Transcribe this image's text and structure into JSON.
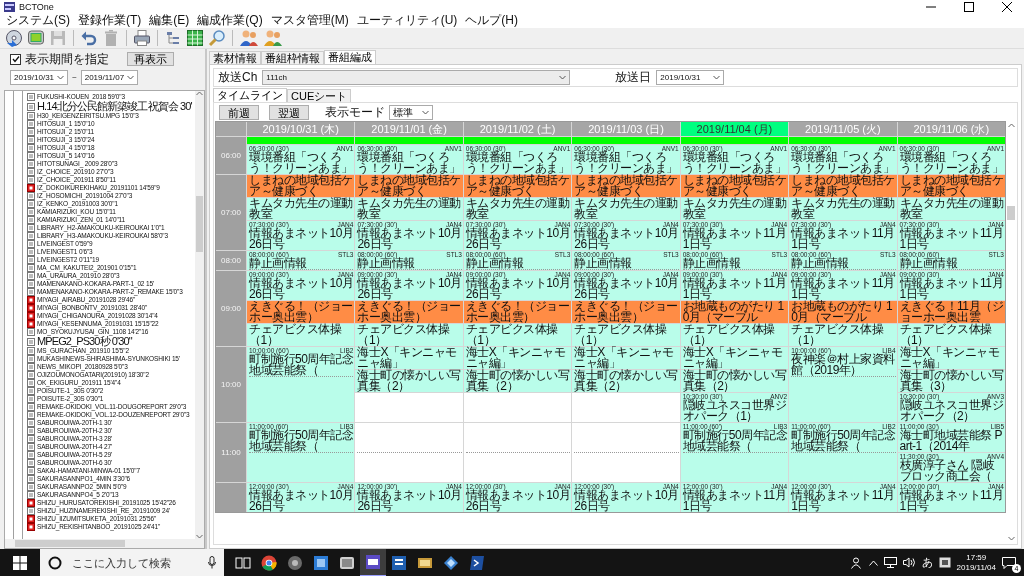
{
  "window": {
    "title": "BCTOne"
  },
  "menu": [
    "システム(S)",
    "登録作業(T)",
    "編集(E)",
    "編成作業(Q)",
    "マスタ管理(M)",
    "ユーティリティ(U)",
    "ヘルプ(H)"
  ],
  "toolbar": [
    {
      "disabled": false
    },
    {
      "disabled": false
    },
    {
      "disabled": true
    },
    {
      "disabled": false
    },
    {
      "disabled": true
    },
    {
      "disabled": false
    },
    {
      "disabled": false
    },
    {
      "disabled": false
    },
    {
      "disabled": false
    },
    {
      "disabled": false
    },
    {
      "disabled": false
    }
  ],
  "filter": {
    "period_checkbox": {
      "label": "表示期間を指定",
      "checked": true
    },
    "refresh_button": "再表示",
    "date_from": "2019/10/31",
    "separator": "~",
    "date_to": "2019/11/07"
  },
  "tree": {
    "items": [
      {
        "label": "FUKUSHI-KOUEN_2018 59'0\"3",
        "flagged": false
      },
      {
        "label": "H.14北分公民館新築竣工祝賀会 30'",
        "flagged": false
      },
      {
        "label": "H30_KEIGENZEIRITSU.MPG 15'0\"3",
        "flagged": false
      },
      {
        "label": "HITOSUJI_1 15'0\"10",
        "flagged": false
      },
      {
        "label": "HITOSUJI_2 15'0\"11",
        "flagged": false
      },
      {
        "label": "HITOSUJI_3 15'0\"24",
        "flagged": false
      },
      {
        "label": "HITOSUJI_4 15'0\"18",
        "flagged": false
      },
      {
        "label": "HITOSUJI_5 14'0\"16",
        "flagged": false
      },
      {
        "label": "HITOTSUNAGI_ 2009 28'0\"3",
        "flagged": false
      },
      {
        "label": "IZ_CHOICE_201910 27'0\"3",
        "flagged": false
      },
      {
        "label": "IZ_CHOICE_201911 8'50\"11",
        "flagged": false
      },
      {
        "label": "IZ_DOKOIKUREKIHAKU_20191101 14'59\"9",
        "flagged": true
      },
      {
        "label": "IZ_HOSOMICHI_20191004 27'0\"3",
        "flagged": false
      },
      {
        "label": "IZ_KENKO_20191003 30'0\"1",
        "flagged": false
      },
      {
        "label": "KAMIARIZUKI_KOU 15'0\"11",
        "flagged": false
      },
      {
        "label": "KAMIARIZUKI_ZEN_01 14'0\"11",
        "flagged": false
      },
      {
        "label": "LIBRARY_H2-AMAKOUKU-KEIROUKAI 1'0\"1",
        "flagged": false
      },
      {
        "label": "LIBRARY_H3-AMAKOUKU-KEIROUKAI 58'0\"3",
        "flagged": false
      },
      {
        "label": "LIVEINGEST 0'59\"9",
        "flagged": false
      },
      {
        "label": "LIVEINGEST1 0'6\"3",
        "flagged": false
      },
      {
        "label": "LIVEINGEST2 0'11\"19",
        "flagged": false
      },
      {
        "label": "MA_CM_KAKUTEI2_201901 0'15\"1",
        "flagged": false
      },
      {
        "label": "MA_URAURA_201910 28'0\"3",
        "flagged": false
      },
      {
        "label": "MAMENAKANO-KOKARA-PART-1_02 15'",
        "flagged": false
      },
      {
        "label": "MAMENAKANO-KOKARA-PART-2_REMAKE 15'0\"3",
        "flagged": false
      },
      {
        "label": "MIYAGI_AIRABU_20191028 29'46\"",
        "flagged": true
      },
      {
        "label": "MIYAGI_BONBONTV_20191031 28'40\"",
        "flagged": true
      },
      {
        "label": "MIYAGI_CHIGANOURA_20191028 30'14\"4",
        "flagged": true
      },
      {
        "label": "MIYAGI_KESENNUMA_20191031 15'15\"22",
        "flagged": true
      },
      {
        "label": "MO_SYOKUJYUSAI_GIN_1108 14'2\"16",
        "flagged": false
      },
      {
        "label": "MPEG2_PS30秒 0'30\"",
        "flagged": false
      },
      {
        "label": "MS_GURACHAN_201910 15'5\"2",
        "flagged": false
      },
      {
        "label": "MUKASHINEWS-SHIRASHIMA-SYUNKOSHIKI 15'",
        "flagged": false
      },
      {
        "label": "NEWS_MIKOPI_20180928 5'0\"3",
        "flagged": false
      },
      {
        "label": "OJIZOUMONOGATARI(201910) 18'30\"2",
        "flagged": false
      },
      {
        "label": "OK_EKIGURU_201911 15'4\"4",
        "flagged": false
      },
      {
        "label": "POISUTE-1_30S 0'30\"2",
        "flagged": false
      },
      {
        "label": "POISUTE-2_30S 0'30\"1",
        "flagged": false
      },
      {
        "label": "REMAKE-OKIDOKI_VOL.11-DOUGOREPORT 29'0\"3",
        "flagged": false
      },
      {
        "label": "REMAKE-OKIDOKI_VOL.12-DOUZENREPORT 29'0\"3",
        "flagged": false
      },
      {
        "label": "SABUROUIWA-20TH-1 30'",
        "flagged": false
      },
      {
        "label": "SABUROUIWA-20TH-2 30'",
        "flagged": false
      },
      {
        "label": "SABUROUIWA-20TH-3 28'",
        "flagged": false
      },
      {
        "label": "SABUROUIWA-20TH-4 27'",
        "flagged": false
      },
      {
        "label": "SABUROUIWA-20TH-5 29'",
        "flagged": false
      },
      {
        "label": "SABUROUIWA-20TH-6 30'",
        "flagged": false
      },
      {
        "label": "SAKAI-HAMATANI-MINWA-01 15'0\"7",
        "flagged": false
      },
      {
        "label": "SAKURASANNPO1_4MIN 3'30\"6",
        "flagged": false
      },
      {
        "label": "SAKURASANNPO2_5MIN 5'0\"9",
        "flagged": false
      },
      {
        "label": "SAKURASANNPO4_5 2'0\"13",
        "flagged": false
      },
      {
        "label": "SHIZU_HURUSATOREKISHI_20191025 15'42\"26",
        "flagged": true
      },
      {
        "label": "SHIZU_HUZINAMEREKISHI_RE_20191009 24'",
        "flagged": false
      },
      {
        "label": "SHIZU_IIZUMITSUKETA_20191031 25'56\"",
        "flagged": true
      },
      {
        "label": "SHIZU_REKISHITANBOO_20191025 24'41\"",
        "flagged": true
      }
    ]
  },
  "tabs": [
    {
      "label": "素材情報",
      "selected": false
    },
    {
      "label": "番組枠情報",
      "selected": false
    },
    {
      "label": "番組編成",
      "selected": true
    }
  ],
  "channel": {
    "label": "放送Ch",
    "value": "111ch"
  },
  "broadcast_date": {
    "label": "放送日",
    "value": "2019/10/31"
  },
  "subtabs": [
    {
      "label": "タイムライン",
      "selected": true
    },
    {
      "label": "CUEシート",
      "selected": false
    }
  ],
  "week_buttons": [
    "前週",
    "翌週"
  ],
  "display_mode": {
    "label": "表示モード",
    "value": "標準"
  },
  "timeline": {
    "hours": [
      "06:00",
      "07:00",
      "08:00",
      "09:00",
      "10:00",
      "11:00"
    ],
    "days": [
      {
        "date": "2019/10/31 (木)",
        "selected": false,
        "blocks": [
          {
            "kind": "filler",
            "long": false
          },
          {
            "kind": "program",
            "long": false,
            "time": "06:30:00 (30')",
            "title": "環境番組「つくろう！クリーンあま」",
            "code": "ANV1"
          },
          {
            "kind": "insert",
            "title": "しまねの地域包括ケア～健康づく"
          },
          {
            "kind": "segment",
            "title": "キムタカ先生の運動教室"
          },
          {
            "kind": "program",
            "long": false,
            "time": "07:30:00 (30')",
            "title": "情報あまネット10月26日号",
            "code": "JAN4"
          },
          {
            "kind": "program",
            "long": true,
            "time": "08:00:00 (60')",
            "title": "静止画情報",
            "code": "STL3"
          },
          {
            "kind": "program",
            "long": false,
            "time": "09:00:00 (30')",
            "title": "情報あまネット10月26日号",
            "code": "JAN4"
          },
          {
            "kind": "insert",
            "title": "えきぐる！（ジョーホー奥出雲）"
          },
          {
            "kind": "segment",
            "title": "チェアビクス体操（1）"
          },
          {
            "kind": "program",
            "long": true,
            "time": "10:00:00 (60')",
            "title": "町制施行50周年記念地域芸能祭（",
            "code": "LIB2"
          },
          {
            "kind": "program",
            "long": true,
            "time": "11:00:00 (60')",
            "title": "町制施行50周年記念地域芸能祭（",
            "code": "LIB3"
          },
          {
            "kind": "program",
            "long": false,
            "time": "12:00:00 (30')",
            "title": "情報あまネット10月26日号",
            "code": "JAN4"
          }
        ]
      },
      {
        "date": "2019/11/01 (金)",
        "selected": false,
        "blocks": [
          {
            "kind": "filler",
            "long": false
          },
          {
            "kind": "program",
            "long": false,
            "time": "06:30:00 (30')",
            "title": "環境番組「つくろう！クリーンあま」",
            "code": "ANV1"
          },
          {
            "kind": "insert",
            "title": "しまねの地域包括ケア～健康づく"
          },
          {
            "kind": "segment",
            "title": "キムタカ先生の運動教室"
          },
          {
            "kind": "program",
            "long": false,
            "time": "07:30:00 (30')",
            "title": "情報あまネット10月26日号",
            "code": "JAN4"
          },
          {
            "kind": "program",
            "long": true,
            "time": "08:00:00 (60')",
            "title": "静止画情報",
            "code": "STL3"
          },
          {
            "kind": "program",
            "long": false,
            "time": "09:00:00 (30')",
            "title": "情報あまネット10月26日号",
            "code": "JAN4"
          },
          {
            "kind": "insert",
            "title": "えきぐる！（ジョーホー奥出雲）"
          },
          {
            "kind": "segment",
            "title": "チェアビクス体操（1）"
          },
          {
            "kind": "segment",
            "title": "海士X「キンニャモニャ編」"
          },
          {
            "kind": "segment",
            "title": "海士町の懐かしい写真集（2）"
          },
          {
            "kind": "empty",
            "long": false
          },
          {
            "kind": "empty",
            "long": true
          },
          {
            "kind": "program",
            "long": false,
            "time": "12:00:00 (30')",
            "title": "情報あまネット10月26日号",
            "code": "JAN4"
          }
        ]
      },
      {
        "date": "2019/11/02 (土)",
        "selected": false,
        "blocks": [
          {
            "kind": "filler",
            "long": false
          },
          {
            "kind": "program",
            "long": false,
            "time": "06:30:00 (30')",
            "title": "環境番組「つくろう！クリーンあま」",
            "code": "ANV1"
          },
          {
            "kind": "insert",
            "title": "しまねの地域包括ケア～健康づく"
          },
          {
            "kind": "segment",
            "title": "キムタカ先生の運動教室"
          },
          {
            "kind": "program",
            "long": false,
            "time": "07:30:00 (30')",
            "title": "情報あまネット10月26日号",
            "code": "JAN4"
          },
          {
            "kind": "program",
            "long": true,
            "time": "08:00:00 (60')",
            "title": "静止画情報",
            "code": "STL3"
          },
          {
            "kind": "program",
            "long": false,
            "time": "09:00:00 (30')",
            "title": "情報あまネット10月26日号",
            "code": "JAN4"
          },
          {
            "kind": "insert",
            "title": "えきぐる！（ジョーホー奥出雲）"
          },
          {
            "kind": "segment",
            "title": "チェアビクス体操（1）"
          },
          {
            "kind": "segment",
            "title": "海士X「キンニャモニャ編」"
          },
          {
            "kind": "segment",
            "title": "海士町の懐かしい写真集（2）"
          },
          {
            "kind": "empty",
            "long": false
          },
          {
            "kind": "empty",
            "long": true
          },
          {
            "kind": "program",
            "long": false,
            "time": "12:00:00 (30')",
            "title": "情報あまネット10月26日号",
            "code": "JAN4"
          }
        ]
      },
      {
        "date": "2019/11/03 (日)",
        "selected": false,
        "blocks": [
          {
            "kind": "filler",
            "long": false
          },
          {
            "kind": "program",
            "long": false,
            "time": "06:30:00 (30')",
            "title": "環境番組「つくろう！クリーンあま」",
            "code": "ANV1"
          },
          {
            "kind": "insert",
            "title": "しまねの地域包括ケア～健康づく"
          },
          {
            "kind": "segment",
            "title": "キムタカ先生の運動教室"
          },
          {
            "kind": "program",
            "long": false,
            "time": "07:30:00 (30')",
            "title": "情報あまネット10月26日号",
            "code": "JAN4"
          },
          {
            "kind": "program",
            "long": true,
            "time": "08:00:00 (60')",
            "title": "静止画情報",
            "code": "STL3"
          },
          {
            "kind": "program",
            "long": false,
            "time": "09:00:00 (30')",
            "title": "情報あまネット10月26日号",
            "code": "JAN4"
          },
          {
            "kind": "insert",
            "title": "えきぐる！（ジョーホー奥出雲）"
          },
          {
            "kind": "segment",
            "title": "チェアビクス体操（1）"
          },
          {
            "kind": "segment",
            "title": "海士X「キンニャモニャ編」"
          },
          {
            "kind": "segment",
            "title": "海士町の懐かしい写真集（2）"
          },
          {
            "kind": "empty",
            "long": false
          },
          {
            "kind": "empty",
            "long": true
          },
          {
            "kind": "program",
            "long": false,
            "time": "12:00:00 (30')",
            "title": "情報あまネット10月26日号",
            "code": "JAN4"
          }
        ]
      },
      {
        "date": "2019/11/04 (月)",
        "selected": true,
        "blocks": [
          {
            "kind": "filler",
            "long": false
          },
          {
            "kind": "program",
            "long": false,
            "time": "06:30:00 (30')",
            "title": "環境番組「つくろう！クリーンあま」",
            "code": "ANV1"
          },
          {
            "kind": "insert",
            "title": "しまねの地域包括ケア～健康づく"
          },
          {
            "kind": "segment",
            "title": "キムタカ先生の運動教室"
          },
          {
            "kind": "program",
            "long": false,
            "time": "07:30:00 (30')",
            "title": "情報あまネット11月1日号",
            "code": "JAN4"
          },
          {
            "kind": "program",
            "long": true,
            "time": "08:00:00 (60')",
            "title": "静止画情報",
            "code": "STL3"
          },
          {
            "kind": "program",
            "long": false,
            "time": "09:00:00 (30')",
            "title": "情報あまネット11月1日号",
            "code": "JAN4"
          },
          {
            "kind": "insert",
            "title": "お地蔵ものがたり 10月（マーブル"
          },
          {
            "kind": "segment",
            "title": "チェアビクス体操（1）"
          },
          {
            "kind": "segment",
            "title": "海士X「キンニャモニャ編」"
          },
          {
            "kind": "segment",
            "title": "海士町の懐かしい写真集（2）"
          },
          {
            "kind": "program",
            "long": false,
            "time": "10:30:00 (30')",
            "title": "隠岐ユネスコ世界ジオパーク（1）",
            "code": "ANV2"
          },
          {
            "kind": "program",
            "long": true,
            "time": "11:00:00 (60')",
            "title": "町制施行50周年記念地域芸能祭（",
            "code": "LIB3"
          },
          {
            "kind": "program",
            "long": false,
            "time": "12:00:00 (30')",
            "title": "情報あまネット11月1日号",
            "code": "JAN4"
          }
        ]
      },
      {
        "date": "2019/11/05 (火)",
        "selected": false,
        "blocks": [
          {
            "kind": "filler",
            "long": false
          },
          {
            "kind": "program",
            "long": false,
            "time": "06:30:00 (30')",
            "title": "環境番組「つくろう！クリーンあま」",
            "code": "ANV1"
          },
          {
            "kind": "insert",
            "title": "しまねの地域包括ケア～健康づく"
          },
          {
            "kind": "segment",
            "title": "キムタカ先生の運動教室"
          },
          {
            "kind": "program",
            "long": false,
            "time": "07:30:00 (30')",
            "title": "情報あまネット11月1日号",
            "code": "JAN4"
          },
          {
            "kind": "program",
            "long": true,
            "time": "08:00:00 (60')",
            "title": "静止画情報",
            "code": "STL3"
          },
          {
            "kind": "program",
            "long": false,
            "time": "09:00:00 (30')",
            "title": "情報あまネット11月1日号",
            "code": "JAN4"
          },
          {
            "kind": "insert",
            "title": "お地蔵ものがたり 10月（マーブル"
          },
          {
            "kind": "segment",
            "title": "チェアビクス体操（1）"
          },
          {
            "kind": "program",
            "long": true,
            "time": "10:00:00 (60')",
            "title": "夜神楽＠村上家資料館（2019年）",
            "code": "LIB4"
          },
          {
            "kind": "program",
            "long": true,
            "time": "11:00:00 (60')",
            "title": "町制施行50周年記念地域芸能祭（",
            "code": "LIB2"
          },
          {
            "kind": "program",
            "long": false,
            "time": "12:00:00 (30')",
            "title": "情報あまネット11月1日号",
            "code": "JAN4"
          }
        ]
      },
      {
        "date": "2019/11/06 (水)",
        "selected": false,
        "blocks": [
          {
            "kind": "filler",
            "long": false
          },
          {
            "kind": "program",
            "long": false,
            "time": "06:30:00 (30')",
            "title": "環境番組「つくろう！クリーンあま」",
            "code": "ANV1"
          },
          {
            "kind": "insert",
            "title": "しまねの地域包括ケア～健康づく"
          },
          {
            "kind": "segment",
            "title": "キムタカ先生の運動教室"
          },
          {
            "kind": "program",
            "long": false,
            "time": "07:30:00 (30')",
            "title": "情報あまネット11月1日号",
            "code": "JAN4"
          },
          {
            "kind": "program",
            "long": true,
            "time": "08:00:00 (60')",
            "title": "静止画情報",
            "code": "STL3"
          },
          {
            "kind": "program",
            "long": false,
            "time": "09:00:00 (30')",
            "title": "情報あまネット11月1日号",
            "code": "JAN4"
          },
          {
            "kind": "insert",
            "title": "えきぐる！11月（ジョーホー奥出雲"
          },
          {
            "kind": "segment",
            "title": "チェアビクス体操（1）"
          },
          {
            "kind": "segment",
            "title": "海士X「キンニャモニャ編」"
          },
          {
            "kind": "segment",
            "title": "海士町の懐かしい写真集（3）"
          },
          {
            "kind": "program",
            "long": false,
            "time": "10:30:00 (30')",
            "title": "隠岐ユネスコ世界ジオパーク（2）",
            "code": "ANV3"
          },
          {
            "kind": "program",
            "long": false,
            "time": "11:00:00 (30')",
            "title": "海士町地域芸能祭 Part-1（2014年",
            "code": "LIB5"
          },
          {
            "kind": "program",
            "long": false,
            "time": "11:30:00 (30')",
            "title": "枝廣淳子さん 隠岐ブロック商工会（",
            "code": "ANV4"
          },
          {
            "kind": "program",
            "long": false,
            "time": "12:00:00 (30')",
            "title": "情報あまネット11月1日号",
            "code": "JAN4"
          }
        ]
      }
    ]
  },
  "taskbar": {
    "search_placeholder": "ここに入力して検索",
    "apps": [
      {
        "active": false
      },
      {
        "active": false
      },
      {
        "active": false
      },
      {
        "active": false
      },
      {
        "active": false
      },
      {
        "active": true
      },
      {
        "active": false
      },
      {
        "active": false
      },
      {
        "active": false
      },
      {
        "active": false
      }
    ],
    "ime": "あ",
    "time": "17:59",
    "date": "2019/11/04",
    "notification_count": "4"
  }
}
